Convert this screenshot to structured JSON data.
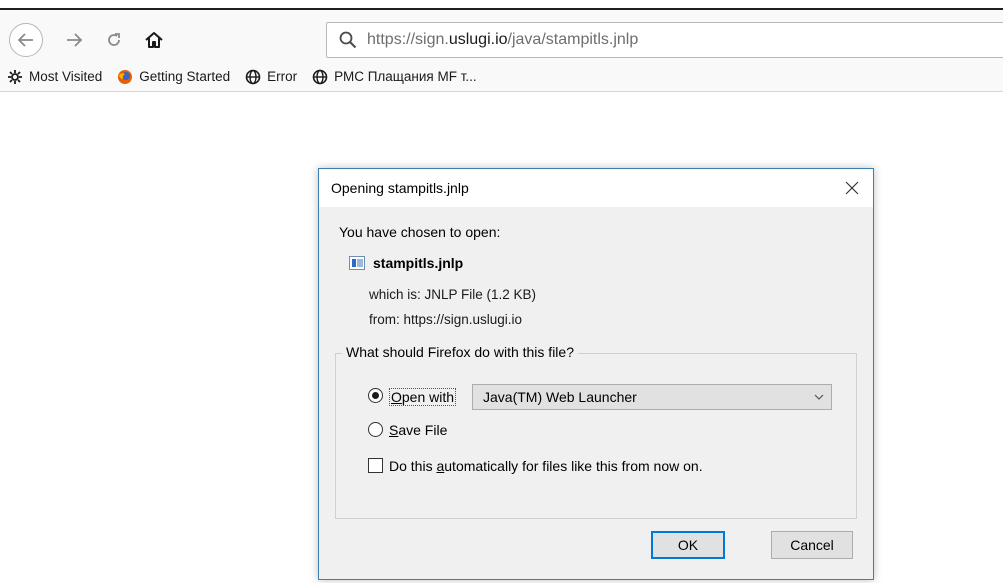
{
  "browser": {
    "url": {
      "scheme_sub": "https://sign.",
      "domain": "uslugi.io",
      "path": "/java/stampitls.jnlp"
    },
    "bookmarks": [
      {
        "label": "Most Visited",
        "icon": "gear-icon"
      },
      {
        "label": "Getting Started",
        "icon": "firefox-icon"
      },
      {
        "label": "Error",
        "icon": "globe-icon"
      },
      {
        "label": "РМС Плащания MF т...",
        "icon": "globe-icon"
      }
    ]
  },
  "dialog": {
    "title": "Opening stampitls.jnlp",
    "chosen_label": "You have chosen to open:",
    "file_name": "stampitls.jnlp",
    "which_is": "which is: JNLP File (1.2 KB)",
    "from": "from: https://sign.uslugi.io",
    "group_label": "What should Firefox do with this file?",
    "open_with": {
      "accel": "O",
      "rest": "pen with",
      "selected": true
    },
    "app_select": "Java(TM) Web Launcher",
    "save_file": {
      "accel": "S",
      "rest": "ave File",
      "selected": false
    },
    "auto": {
      "pre": "Do this ",
      "accel": "a",
      "post": "utomatically for files like this from now on.",
      "checked": false
    },
    "ok_label": "OK",
    "cancel_label": "Cancel"
  },
  "colors": {
    "accent": "#0078d7",
    "dialog_border": "#3c7fb1",
    "dialog_bg": "#f0f0f0"
  }
}
